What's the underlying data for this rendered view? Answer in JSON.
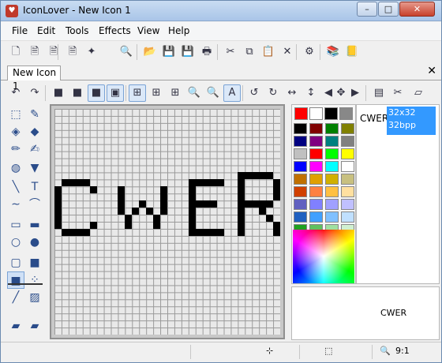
{
  "window": {
    "title": "IconLover - New Icon 1",
    "app_icon": "heart-icon",
    "buttons": {
      "minimize": "–",
      "maximize": "□",
      "close": "✕"
    }
  },
  "menu": {
    "items": [
      "File",
      "Edit",
      "Tools",
      "Effects",
      "View",
      "Help"
    ]
  },
  "toolbar1": {
    "icons": [
      "new-file-icon",
      "new-doc-icon",
      "document-icon",
      "image-icon",
      "extract-icon",
      "scan-icon",
      "folder-open-icon",
      "save-icon",
      "save-all-icon",
      "print-icon",
      "cut-icon",
      "copy-icon",
      "paste-icon",
      "delete-icon",
      "properties-icon",
      "library-icon",
      "book-icon"
    ],
    "glyphs": [
      "🗋",
      "🗎",
      "🗎",
      "🗎",
      "✦",
      "🔍",
      "📂",
      "💾",
      "💾",
      "🖶",
      "✂",
      "⧉",
      "📋",
      "✕",
      "⚙",
      "📚",
      "📒"
    ]
  },
  "toolbar2": {
    "icons": [
      "undo-icon",
      "redo-icon",
      "cube-green-icon",
      "cube-yellow-icon",
      "cube-blue-icon",
      "square-gradient-icon",
      "grid-icon",
      "grid-small-icon",
      "grid-3d-icon",
      "zoom-in-icon",
      "zoom-out-icon",
      "zoom-fit-icon",
      "rotate-left-icon",
      "rotate-right-icon",
      "flip-horizontal-icon",
      "flip-vertical-icon",
      "arrow-left-icon",
      "arrow-up-down-icon",
      "arrow-right-icon",
      "page-icon",
      "crop-icon",
      "eraser-all-icon"
    ],
    "glyphs": [
      "↶",
      "↷",
      "■",
      "■",
      "■",
      "▣",
      "⊞",
      "⊞",
      "⊞",
      "🔍",
      "🔍",
      "A",
      "↺",
      "↻",
      "↔",
      "↕",
      "◀",
      "✥",
      "▶",
      "▤",
      "✂",
      "▱"
    ]
  },
  "tab": {
    "label": "New Icon 1",
    "close": "✕"
  },
  "left_tools": {
    "icons": [
      "rect-select-icon",
      "pipette-icon",
      "fill-icon",
      "eraser-icon",
      "pencil-icon",
      "color-replace-icon",
      "spray-icon",
      "paint-fill-icon",
      "line-icon",
      "text-icon",
      "curve-icon",
      "arc-icon",
      "rect-outline-icon",
      "rect-filled-icon",
      "ellipse-outline-icon",
      "ellipse-filled-icon",
      "rounded-rect-outline-icon",
      "rounded-rect-filled-icon",
      "brush-small-icon",
      "brush-spray-icon",
      "pen-thick-icon",
      "gradient-icon",
      "layer-icon",
      "layer-stack-icon"
    ],
    "glyphs": [
      "⬚",
      "✎",
      "◈",
      "◆",
      "✏",
      "✍",
      "◍",
      "▼",
      "╲",
      "T",
      "∼",
      "⌒",
      "▭",
      "▬",
      "○",
      "●",
      "▢",
      "■",
      "■",
      "⁘",
      "╱",
      "▨",
      "▰",
      "▰"
    ]
  },
  "canvas": {
    "text": "CWER",
    "grid_size": 32
  },
  "palette": {
    "primary": "#ff0000",
    "top_row": [
      "#ff0000",
      "#ffffff",
      "#000000",
      "#888888"
    ],
    "rows": [
      [
        "#000000",
        "#800000",
        "#008000",
        "#808000"
      ],
      [
        "#000080",
        "#800080",
        "#008080",
        "#808080"
      ],
      [
        "#c0c0c0",
        "#ff0000",
        "#00ff00",
        "#ffff00"
      ],
      [
        "#0000ff",
        "#ff00ff",
        "#00ffff",
        "#ffffff"
      ],
      [
        "#c07000",
        "#e0a000",
        "#d0b000",
        "#c8c080"
      ],
      [
        "#d04000",
        "#ff8040",
        "#ffc040",
        "#ffe0a0"
      ],
      [
        "#6060c0",
        "#8080ff",
        "#a0a0ff",
        "#c0c0ff"
      ],
      [
        "#2060c0",
        "#40a0ff",
        "#80c0ff",
        "#c0e0ff"
      ],
      [
        "#20a020",
        "#60c060",
        "#a0e0a0",
        "#d0f0d0"
      ]
    ]
  },
  "formats": {
    "name": "CWER",
    "size": "32x32",
    "depth": "32bpp"
  },
  "preview": {
    "text": "CWER"
  },
  "status": {
    "cell1_icon": "cursor-position-icon",
    "cell2_icon": "selection-size-icon",
    "zoom_icon": "zoom-icon",
    "zoom": "9:1"
  }
}
